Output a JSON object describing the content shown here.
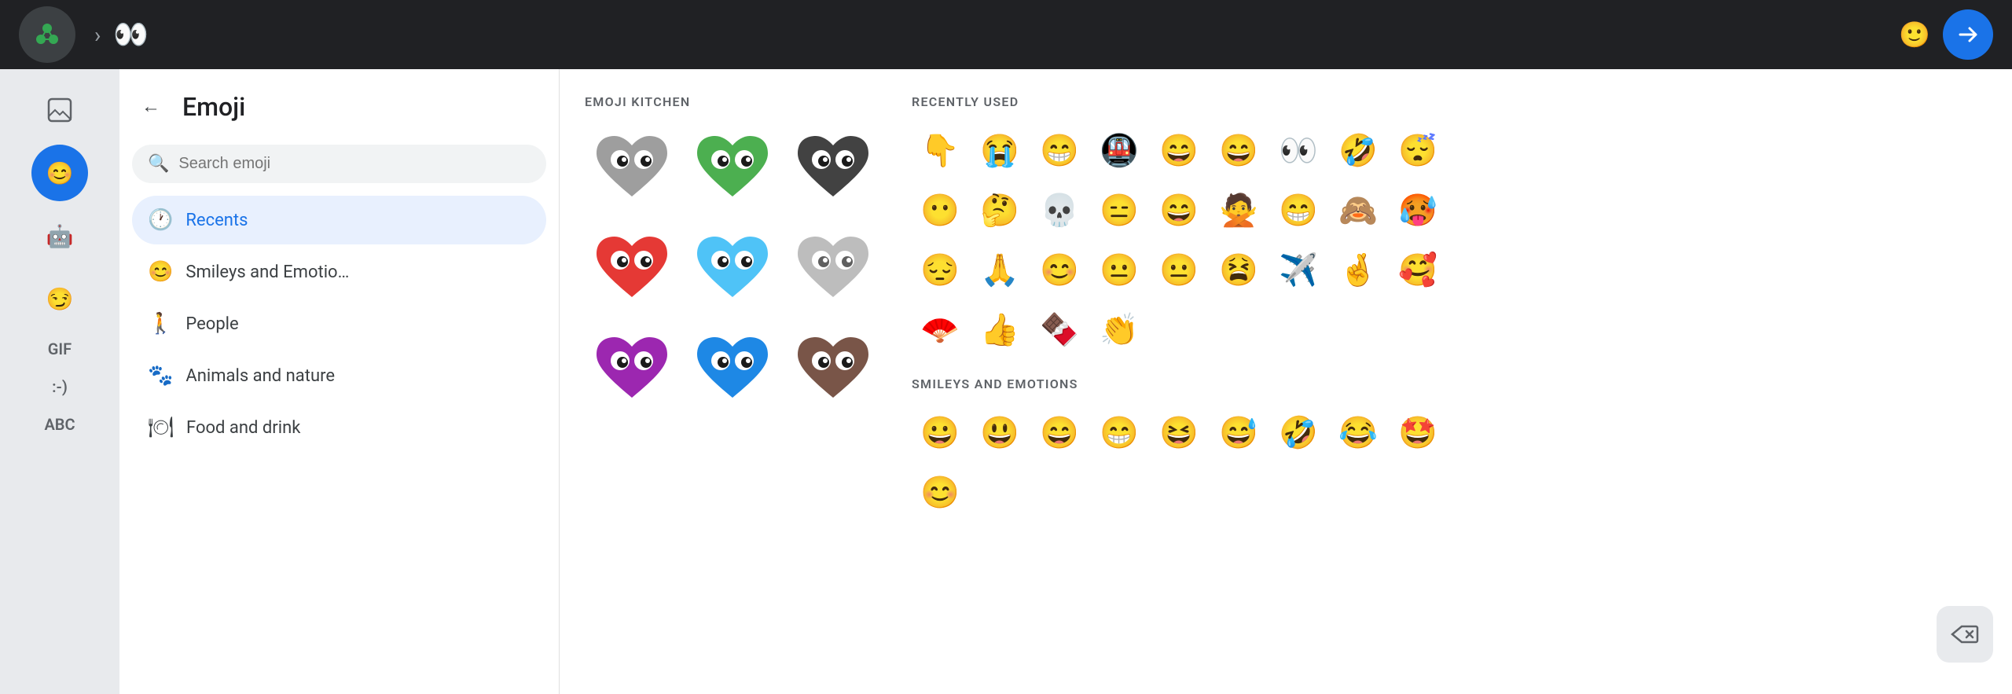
{
  "topbar": {
    "input_text": "👀",
    "send_label": "➤",
    "smiley_icon": "🙂"
  },
  "sidebar": {
    "icons": [
      {
        "name": "sticker-icon",
        "symbol": "🖼",
        "active": false,
        "label": ""
      },
      {
        "name": "emoji-icon",
        "symbol": "😊",
        "active": true,
        "label": ""
      },
      {
        "name": "bot-icon",
        "symbol": "🤖",
        "active": false,
        "label": ""
      },
      {
        "name": "action-icon",
        "symbol": "😏",
        "active": false,
        "label": ""
      },
      {
        "name": "gif-label",
        "symbol": "",
        "text": "GIF",
        "active": false
      },
      {
        "name": "text-emoji-label",
        "symbol": "",
        "text": ":-)",
        "active": false
      },
      {
        "name": "abc-label",
        "symbol": "",
        "text": "ABC",
        "active": false
      }
    ]
  },
  "emoji_panel": {
    "back_label": "←",
    "title": "Emoji",
    "search_placeholder": "Search emoji",
    "categories": [
      {
        "id": "recents",
        "icon": "🕐",
        "label": "Recents",
        "active": true
      },
      {
        "id": "smileys",
        "icon": "😊",
        "label": "Smileys and Emotio…",
        "active": false
      },
      {
        "id": "people",
        "icon": "🚶",
        "label": "People",
        "active": false
      },
      {
        "id": "animals",
        "icon": "🐾",
        "label": "Animals and nature",
        "active": false
      },
      {
        "id": "food",
        "icon": "🍽",
        "label": "Food and drink",
        "active": false
      }
    ]
  },
  "emoji_kitchen": {
    "title": "EMOJI KITCHEN",
    "items": [
      {
        "emoji": "🩶👀",
        "bg": "#9e9e9e"
      },
      {
        "emoji": "💚👀",
        "bg": "#4caf50"
      },
      {
        "emoji": "🖤👀",
        "bg": "#424242"
      },
      {
        "emoji": "❤️👀",
        "bg": "#f44336"
      },
      {
        "emoji": "🩵👀",
        "bg": "#4fc3f7"
      },
      {
        "emoji": "🩶👀",
        "bg": "#bdbdbd"
      },
      {
        "emoji": "💜👀",
        "bg": "#9c27b0"
      },
      {
        "emoji": "💙👀",
        "bg": "#2196f3"
      },
      {
        "emoji": "🤎👀",
        "bg": "#795548"
      }
    ]
  },
  "recently_used": {
    "title": "RECENTLY USED",
    "emojis": [
      "👇",
      "😭",
      "😁",
      "🚇",
      "😄",
      "😄",
      "👀",
      "🤣",
      "😴",
      "😶",
      "🤔",
      "💀",
      "😑",
      "😄",
      "🙅",
      "😁",
      "🙈",
      "🥵",
      "😔",
      "🙏",
      "😊",
      "😐",
      "😐",
      "😫",
      "✈️",
      "🤞",
      "🥰",
      "🪭",
      "👍",
      "🍫",
      "👏"
    ]
  },
  "smileys_emotions": {
    "title": "SMILEYS AND EMOTIONS",
    "emojis": [
      "😀",
      "😃",
      "😄",
      "😁",
      "😆",
      "😅",
      "🤣",
      "😂",
      "🤩",
      "😊"
    ]
  },
  "delete_btn": "⌫"
}
